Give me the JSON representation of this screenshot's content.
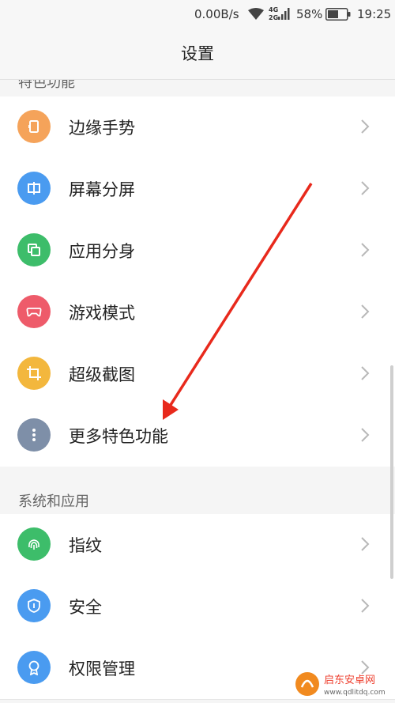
{
  "status_bar": {
    "speed": "0.00B/s",
    "signal_4g": "4G",
    "signal_2g": "2G",
    "battery_percent": "58%",
    "time": "19:25",
    "icons": [
      "wifi-icon",
      "cell-signal-icon",
      "battery-icon"
    ],
    "battery_level": 0.58
  },
  "header": {
    "title": "设置"
  },
  "sections": {
    "special_features": {
      "title": "特色功能",
      "items": [
        {
          "label": "边缘手势",
          "icon": "edge-gesture-icon",
          "color": "#f5a35a"
        },
        {
          "label": "屏幕分屏",
          "icon": "split-screen-icon",
          "color": "#4a9bf0"
        },
        {
          "label": "应用分身",
          "icon": "app-clone-icon",
          "color": "#3dbd6a"
        },
        {
          "label": "游戏模式",
          "icon": "gamepad-icon",
          "color": "#ee5b6a"
        },
        {
          "label": "超级截图",
          "icon": "screenshot-crop-icon",
          "color": "#f3b73d"
        },
        {
          "label": "更多特色功能",
          "icon": "more-dots-icon",
          "color": "#7e8fa8"
        }
      ]
    },
    "system_apps": {
      "title": "系统和应用",
      "items": [
        {
          "label": "指纹",
          "icon": "fingerprint-icon",
          "color": "#3dbd6a"
        },
        {
          "label": "安全",
          "icon": "shield-icon",
          "color": "#4a9bf0"
        },
        {
          "label": "权限管理",
          "icon": "permission-badge-icon",
          "color": "#4a9bf0"
        }
      ]
    }
  },
  "watermark": {
    "brand": "启东安卓网",
    "url": "www.qdlitdq.com"
  },
  "colors": {
    "arrow": "#e8291c",
    "background": "#f5f5f5",
    "row_background": "#ffffff"
  }
}
